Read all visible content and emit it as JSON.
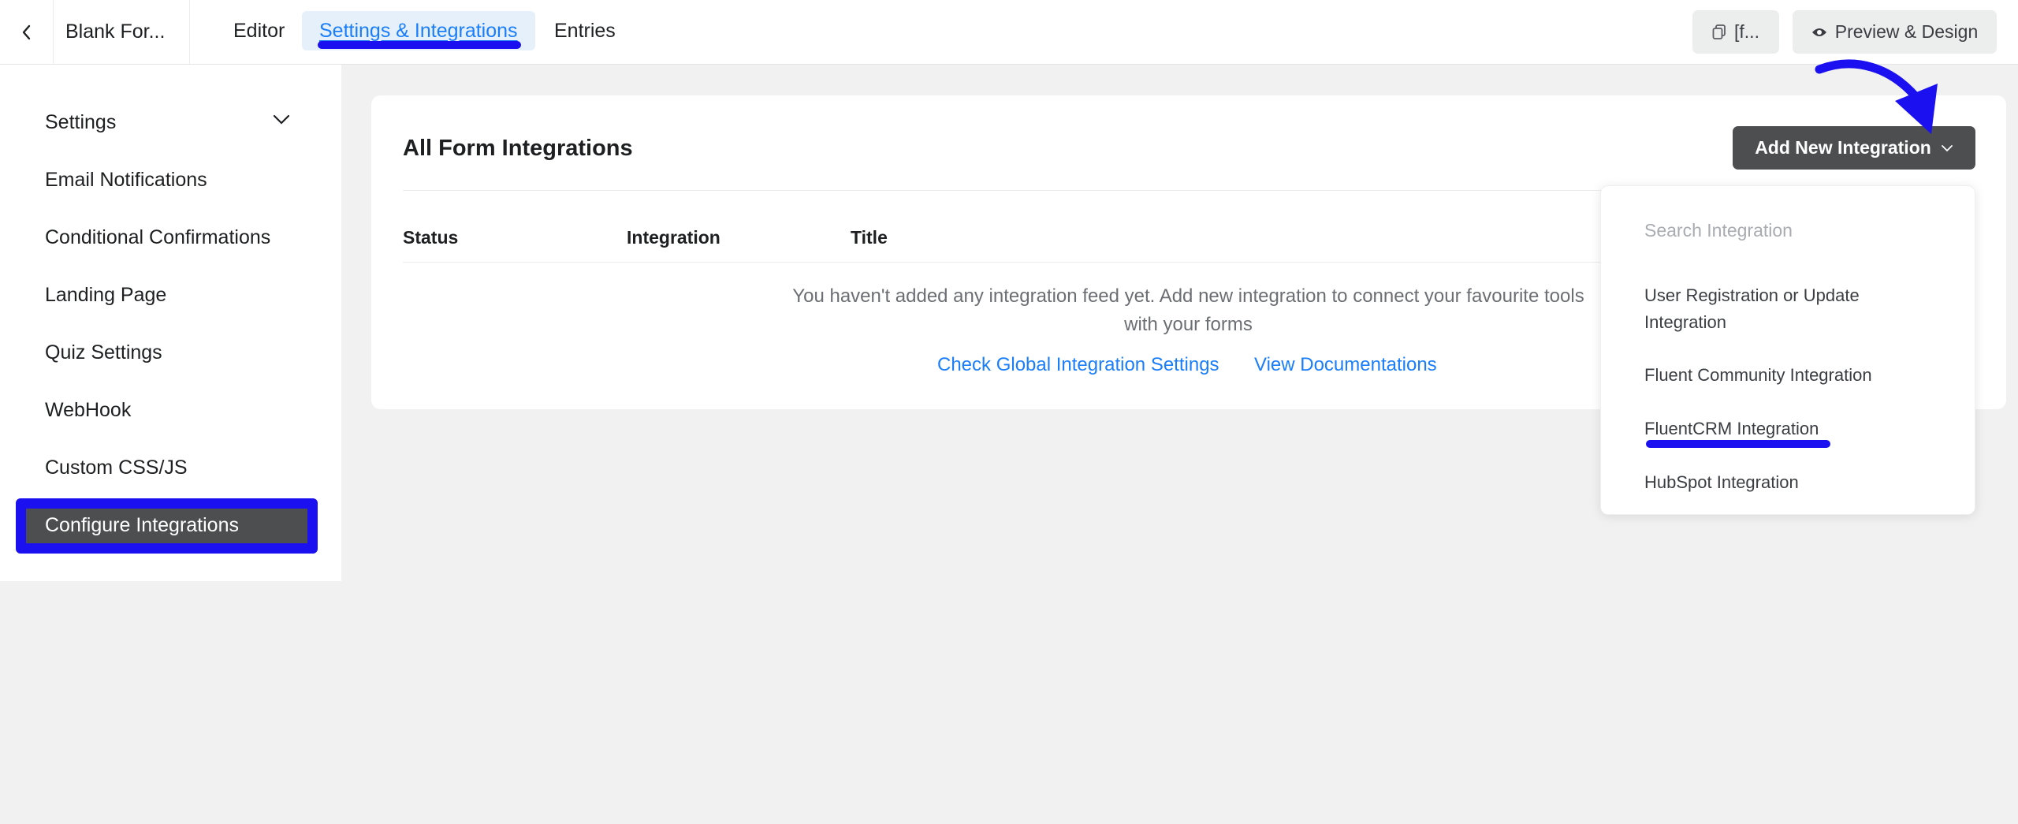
{
  "topbar": {
    "form_name": "Blank For...",
    "tabs": [
      {
        "label": "Editor"
      },
      {
        "label": "Settings & Integrations"
      },
      {
        "label": "Entries"
      }
    ],
    "shortcode_label": "[f...",
    "preview_label": "Preview & Design"
  },
  "sidebar": {
    "items": [
      {
        "label": "Settings"
      },
      {
        "label": "Email Notifications"
      },
      {
        "label": "Conditional Confirmations"
      },
      {
        "label": "Landing Page"
      },
      {
        "label": "Quiz Settings"
      },
      {
        "label": "WebHook"
      },
      {
        "label": "Custom CSS/JS"
      },
      {
        "label": "Configure Integrations"
      }
    ]
  },
  "main": {
    "title": "All Form Integrations",
    "add_button_label": "Add New Integration",
    "columns": [
      "Status",
      "Integration",
      "Title"
    ],
    "empty_message": "You haven't added any integration feed yet. Add new integration to connect your favourite tools with your forms",
    "links": [
      "Check Global Integration Settings",
      "View Documentations"
    ]
  },
  "dropdown": {
    "search_placeholder": "Search Integration",
    "items": [
      {
        "label": "User Registration or Update Integration"
      },
      {
        "label": "Fluent Community Integration"
      },
      {
        "label": "FluentCRM Integration"
      },
      {
        "label": "HubSpot Integration"
      }
    ]
  },
  "colors": {
    "accent": "#1a7efb",
    "annotation": "#1a10f0",
    "dark_button": "#4c4e50"
  },
  "icons": [
    "chevron-left-icon",
    "chevron-down-icon",
    "copy-icon",
    "eye-icon",
    "arrow-annotation-icon"
  ]
}
